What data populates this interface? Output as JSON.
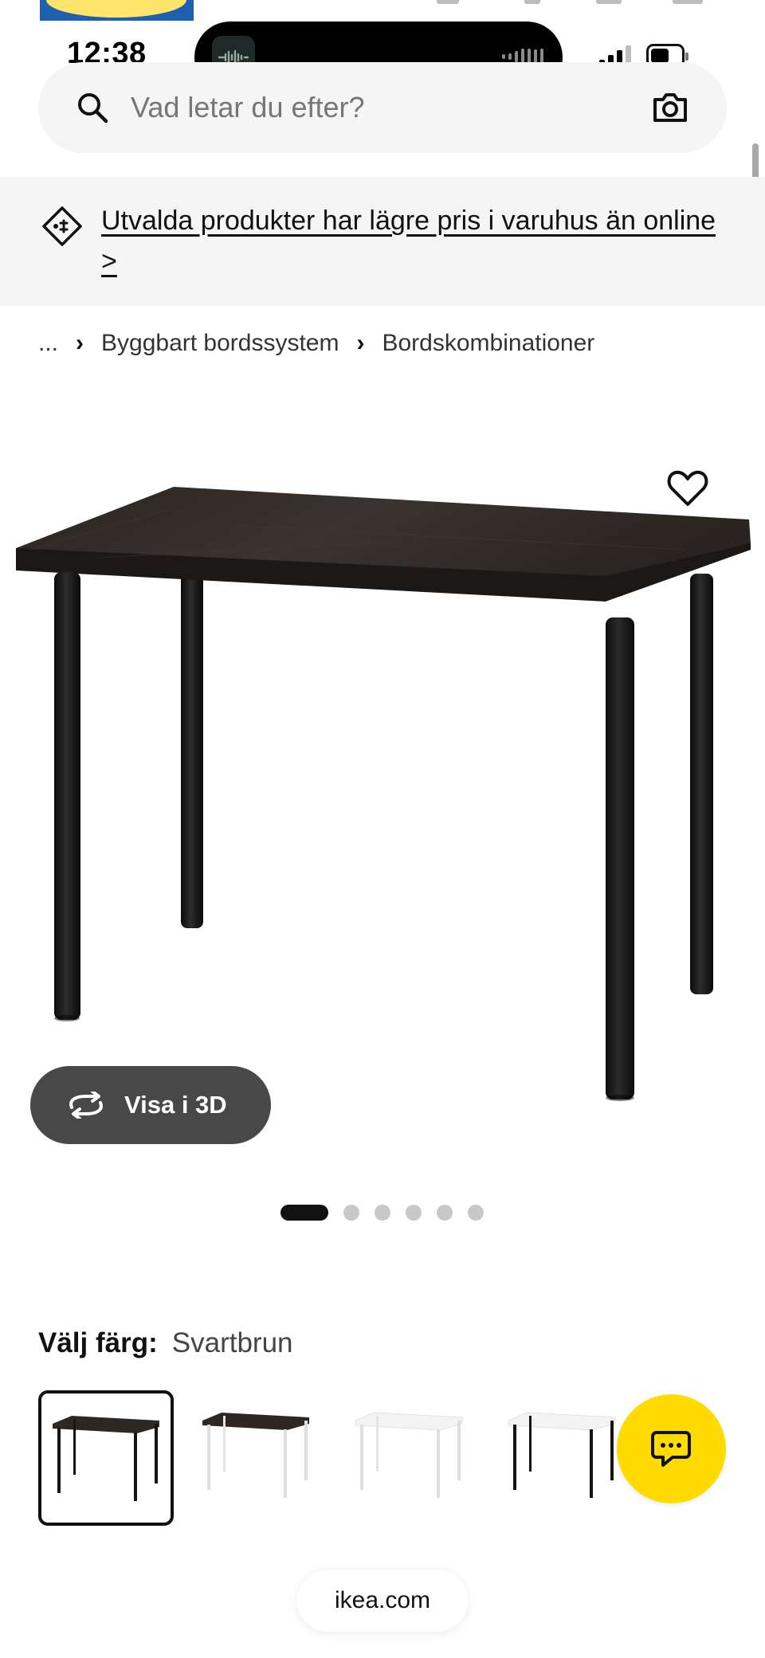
{
  "status_bar": {
    "time": "12:38"
  },
  "search": {
    "placeholder": "Vad letar du efter?"
  },
  "promo": {
    "text": "Utvalda produkter har lägre pris i varuhus än online >"
  },
  "breadcrumb": {
    "items": [
      "...",
      "Byggbart bordssystem",
      "Bordskombinationer"
    ]
  },
  "product": {
    "view_3d_label": "Visa i 3D",
    "carousel": {
      "total": 6,
      "active_index": 0
    }
  },
  "color_selector": {
    "label": "Välj färg:",
    "selected": "Svartbrun",
    "options": [
      {
        "top": "#2e2824",
        "legs": "#151515",
        "selected": true
      },
      {
        "top": "#2e2824",
        "legs": "#e6e6e6",
        "selected": false
      },
      {
        "top": "#f6f6f6",
        "legs": "#e6e6e6",
        "selected": false
      },
      {
        "top": "#f6f6f6",
        "legs": "#151515",
        "selected": false
      }
    ]
  },
  "browser": {
    "url": "ikea.com"
  },
  "colors": {
    "accent_yellow": "#ffdb00",
    "brand_blue": "#1f5fb0"
  }
}
